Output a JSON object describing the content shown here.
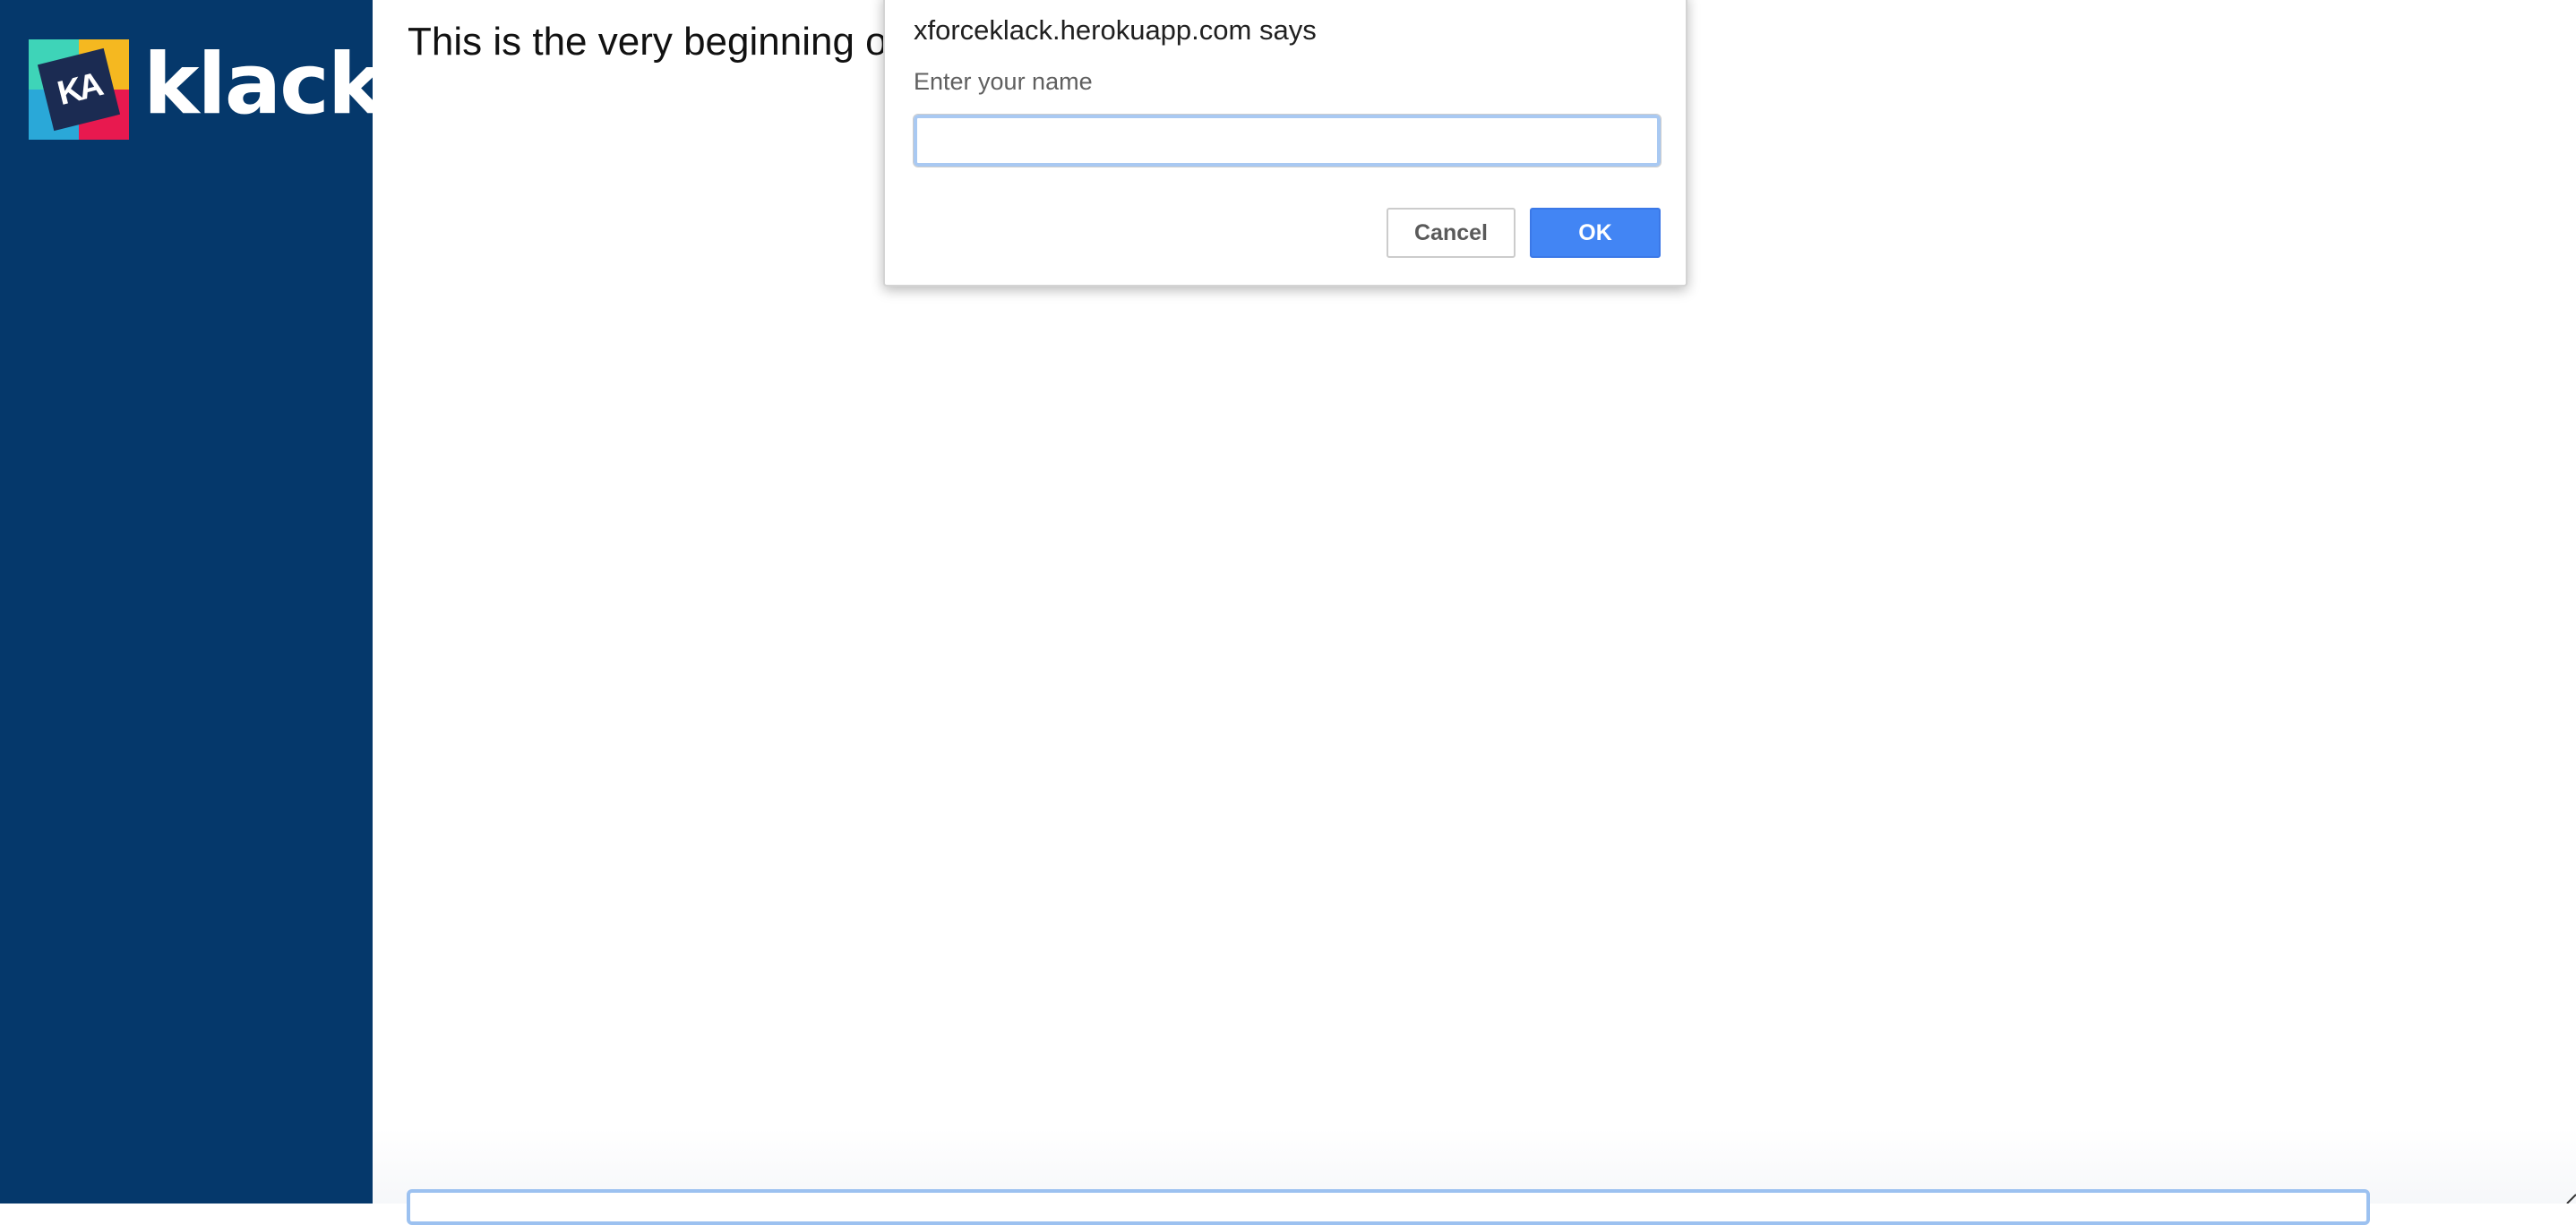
{
  "app": {
    "brand_name": "klack",
    "logo_mark_text": "KA",
    "colors": {
      "sidebar": "#05386b",
      "ok_button": "#4285f4",
      "input_focus": "#a9c9f2"
    }
  },
  "main": {
    "heading_text": "This is the very beginning of th"
  },
  "dialog": {
    "title": "xforceklack.herokuapp.com says",
    "message": "Enter your name",
    "input_value": "",
    "cancel_label": "Cancel",
    "ok_label": "OK"
  }
}
